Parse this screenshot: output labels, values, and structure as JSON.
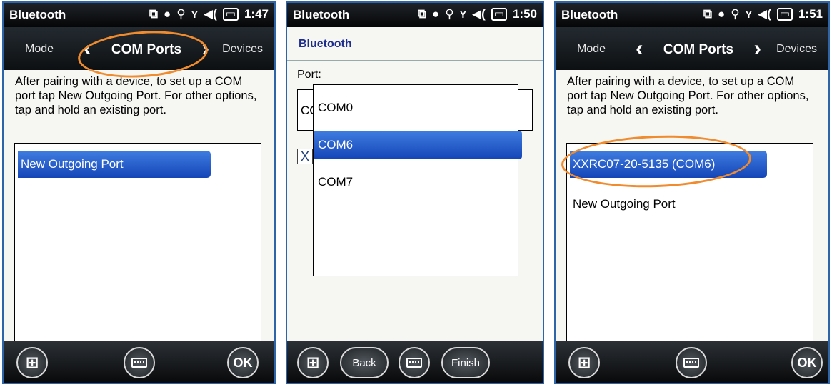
{
  "colors": {
    "accent_highlight": "#2a5fcc",
    "annotation_orange": "#f08b2e",
    "title_bar": "#0d1012",
    "dialog_title": "#1c2d8c"
  },
  "screens": [
    {
      "status": {
        "title": "Bluetooth",
        "time": "1:47"
      },
      "nav": {
        "left": "Mode",
        "center": "COM Ports",
        "right": "Devices"
      },
      "description": "After pairing with a device, to set up a COM port tap New Outgoing Port. For other options, tap and hold an existing port.",
      "list": [
        {
          "label": "New Outgoing Port",
          "selected": true
        }
      ],
      "bottom": {
        "right_button": "OK"
      },
      "annotation": "nav-center"
    },
    {
      "status": {
        "title": "Bluetooth",
        "time": "1:50"
      },
      "dialog_title": "Bluetooth",
      "port_label": "Port:",
      "combo_value": "CO",
      "checkbox": "X",
      "dropdown_options": [
        {
          "label": "COM0",
          "selected": false
        },
        {
          "label": "COM6",
          "selected": true
        },
        {
          "label": "COM7",
          "selected": false
        }
      ],
      "bottom": {
        "back": "Back",
        "finish": "Finish"
      }
    },
    {
      "status": {
        "title": "Bluetooth",
        "time": "1:51"
      },
      "nav": {
        "left": "Mode",
        "center": "COM Ports",
        "right": "Devices"
      },
      "description": "After pairing with a device, to set up a COM port tap New Outgoing Port. For other options, tap and hold an existing port.",
      "list": [
        {
          "label": "XXRC07-20-5135 (COM6)",
          "selected": true
        },
        {
          "label": "New Outgoing Port",
          "selected": false
        }
      ],
      "bottom": {
        "right_button": "OK"
      },
      "annotation": "first-list-item"
    }
  ],
  "icons": [
    "windows-start-icon",
    "keyboard-icon",
    "sync-icon",
    "battery-icon",
    "volume-icon",
    "signal-icon",
    "chevron-left-icon",
    "chevron-right-icon"
  ]
}
